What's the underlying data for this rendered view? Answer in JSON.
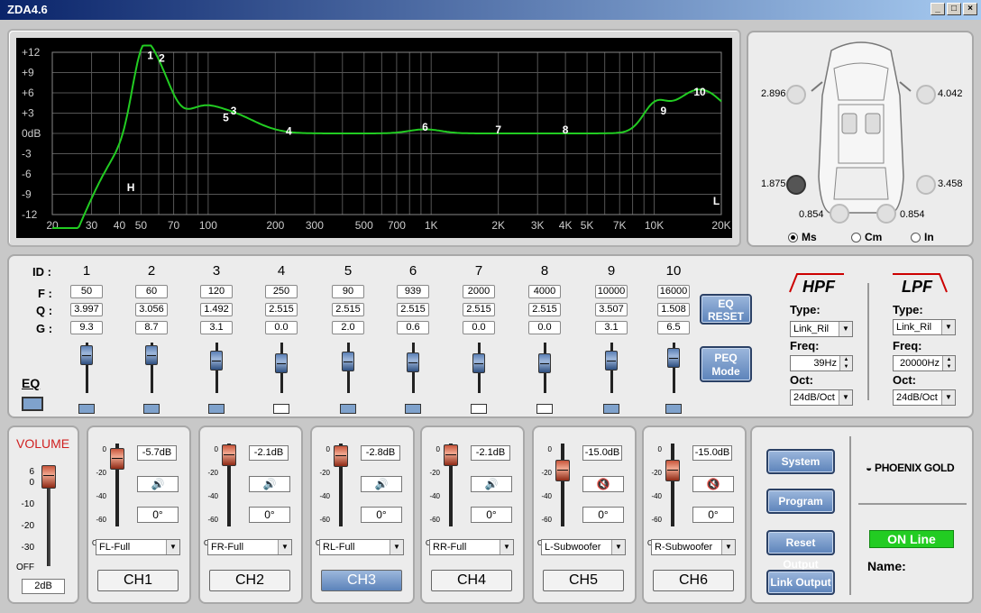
{
  "window": {
    "title": "ZDA4.6",
    "buttons": [
      "_",
      "□",
      "×"
    ]
  },
  "graph": {
    "y_ticks": [
      "+12",
      "+9",
      "+6",
      "+3",
      "0dB",
      "-3",
      "-6",
      "-9",
      "-12"
    ],
    "x_ticks": [
      "20",
      "30",
      "40",
      "50",
      "70",
      "100",
      "200",
      "300",
      "500",
      "700",
      "1K",
      "2K",
      "3K",
      "4K",
      "5K",
      "7K",
      "10K",
      "20K"
    ],
    "markers": [
      {
        "label": "1"
      },
      {
        "label": "2"
      },
      {
        "label": "3"
      },
      {
        "label": "4"
      },
      {
        "label": "5"
      },
      {
        "label": "6"
      },
      {
        "label": "7"
      },
      {
        "label": "8"
      },
      {
        "label": "9"
      },
      {
        "label": "10"
      },
      {
        "label": "H"
      },
      {
        "label": "L"
      }
    ],
    "curve_color": "#22cc22"
  },
  "car": {
    "speakers": {
      "fl": "2.896",
      "fr": "4.042",
      "rl": "1.875",
      "rr": "3.458",
      "sl": "0.854",
      "sr": "0.854"
    },
    "units": [
      "Ms",
      "Cm",
      "In"
    ],
    "unit_selected": "Ms"
  },
  "eq": {
    "row_labels": {
      "id": "ID :",
      "f": "F :",
      "q": "Q :",
      "g": "G :"
    },
    "bands": [
      {
        "id": "1",
        "f": "50",
        "q": "3.997",
        "g": "9.3",
        "enabled": true
      },
      {
        "id": "2",
        "f": "60",
        "q": "3.056",
        "g": "8.7",
        "enabled": true
      },
      {
        "id": "3",
        "f": "120",
        "q": "1.492",
        "g": "3.1",
        "enabled": true
      },
      {
        "id": "4",
        "f": "250",
        "q": "2.515",
        "g": "0.0",
        "enabled": false
      },
      {
        "id": "5",
        "f": "90",
        "q": "2.515",
        "g": "2.0",
        "enabled": true
      },
      {
        "id": "6",
        "f": "939",
        "q": "2.515",
        "g": "0.6",
        "enabled": true
      },
      {
        "id": "7",
        "f": "2000",
        "q": "2.515",
        "g": "0.0",
        "enabled": false
      },
      {
        "id": "8",
        "f": "4000",
        "q": "2.515",
        "g": "0.0",
        "enabled": false
      },
      {
        "id": "9",
        "f": "10000",
        "q": "3.507",
        "g": "3.1",
        "enabled": true
      },
      {
        "id": "10",
        "f": "16000",
        "q": "1.508",
        "g": "6.5",
        "enabled": true
      }
    ],
    "eq_label": "EQ",
    "reset_label": "EQ\nRESET",
    "peq_label": "PEQ\nMode"
  },
  "hpf": {
    "title": "HPF",
    "type_label": "Type",
    "type": "Link_Ril",
    "freq_label": "Freq",
    "freq": "39Hz",
    "oct_label": "Oct",
    "oct": "24dB/Oct"
  },
  "lpf": {
    "title": "LPF",
    "type_label": "Type",
    "type": "Link_Ril",
    "freq_label": "Freq",
    "freq": "20000Hz",
    "oct_label": "Oct",
    "oct": "24dB/Oct"
  },
  "volume": {
    "title": "VOLUME",
    "scale": [
      "6",
      "0",
      "-10",
      "-20",
      "-30",
      "OFF"
    ],
    "value": "2dB",
    "level_db": 2
  },
  "channels": [
    {
      "name": "CH1",
      "db": "-5.7dB",
      "phase": "0°",
      "output": "FL-Full",
      "muted": false,
      "active": false
    },
    {
      "name": "CH2",
      "db": "-2.1dB",
      "phase": "0°",
      "output": "FR-Full",
      "muted": false,
      "active": false
    },
    {
      "name": "CH3",
      "db": "-2.8dB",
      "phase": "0°",
      "output": "RL-Full",
      "muted": false,
      "active": true
    },
    {
      "name": "CH4",
      "db": "-2.1dB",
      "phase": "0°",
      "output": "RR-Full",
      "muted": false,
      "active": false
    },
    {
      "name": "CH5",
      "db": "-15.0dB",
      "phase": "0°",
      "output": "L-Subwoofer",
      "muted": true,
      "active": false
    },
    {
      "name": "CH6",
      "db": "-15.0dB",
      "phase": "0°",
      "output": "R-Subwoofer",
      "muted": true,
      "active": false
    }
  ],
  "ch_scale": [
    "0",
    "-20",
    "-40",
    "-60",
    "OFF"
  ],
  "system": {
    "buttons": [
      "System",
      "Program",
      "Reset Output",
      "Link Output"
    ],
    "brand": "PHOENIX GOLD",
    "status": "ON Line",
    "name_label": "Name:"
  }
}
